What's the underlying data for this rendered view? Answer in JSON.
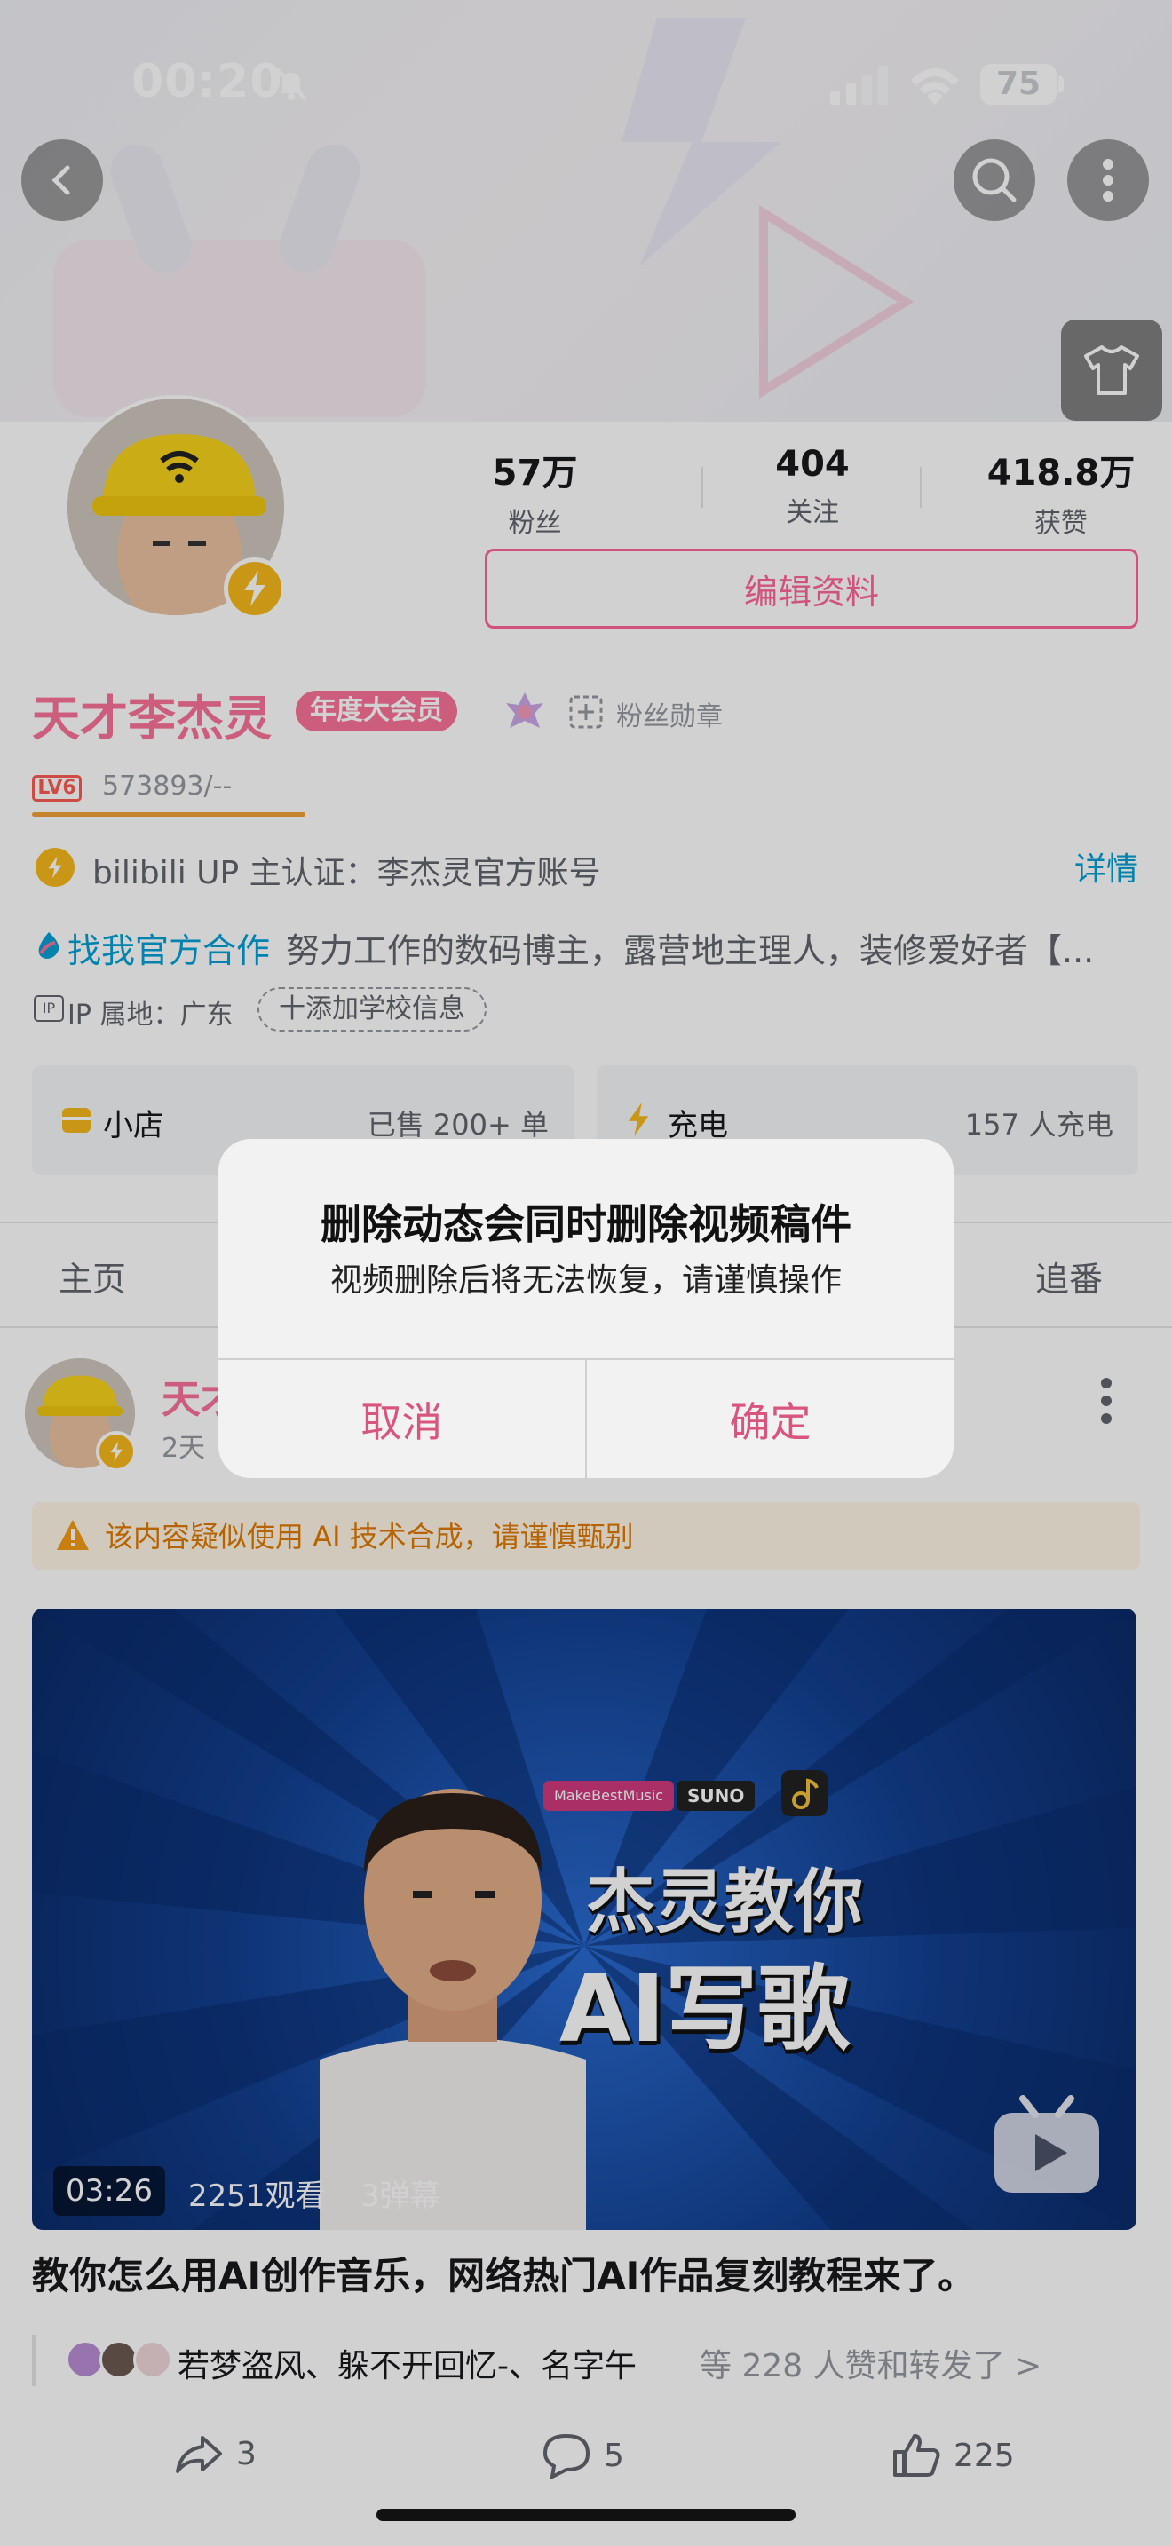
{
  "status_bar": {
    "time": "00:20",
    "battery": "75"
  },
  "header": {
    "back_icon": "chevron-left-icon",
    "search_icon": "search-icon",
    "more_icon": "more-vertical-icon",
    "dress_icon": "tshirt-icon"
  },
  "profile": {
    "stats": [
      {
        "value": "57万",
        "label": "粉丝"
      },
      {
        "value": "404",
        "label": "关注"
      },
      {
        "value": "418.8万",
        "label": "获赞"
      }
    ],
    "edit_button": "编辑资料",
    "name": "天才李杰灵",
    "vip_badge": "年度大会员",
    "fan_medal": "粉丝勋章",
    "level": "LV6",
    "exp": "573893/--",
    "certification": "bilibili UP 主认证：李杰灵官方账号",
    "detail_link": "详情",
    "bio_link": "找我官方合作",
    "bio": "努力工作的数码博主，露营地主理人，装修爱好者【...",
    "ip_label": "IP",
    "ip_location": "IP 属地：广东",
    "add_school": "十添加学校信息",
    "shop": {
      "title": "小店",
      "sub": "已售 200+ 单"
    },
    "charge": {
      "title": "充电",
      "sub": "157 人充电"
    }
  },
  "tabs": {
    "first": "主页",
    "last": "追番"
  },
  "post": {
    "author_partial": "天才",
    "time_partial": "2天",
    "ai_warning": "该内容疑似使用 AI 技术合成，请谨慎甄别",
    "video": {
      "tag1": "MakeBestMusic",
      "tag2": "SUNO",
      "title_line1": "杰灵教你",
      "title_line2": "AI写歌",
      "duration": "03:26",
      "views": "2251观看",
      "danmaku": "3弹幕"
    },
    "title": "教你怎么用AI创作音乐，网络热门AI作品复刻教程来了。",
    "likers": "若梦盗风、躲不开回忆-、名字午",
    "likes_more": "等 228 人赞和转发了 >",
    "actions": {
      "share": "3",
      "comment": "5",
      "like": "225"
    }
  },
  "dialog": {
    "title": "删除动态会同时删除视频稿件",
    "message": "视频删除后将无法恢复，请谨慎操作",
    "cancel": "取消",
    "confirm": "确定"
  },
  "colors": {
    "brand_pink": "#fb7299",
    "link_blue": "#00a1d6",
    "dialog_btn": "#d9557d"
  }
}
